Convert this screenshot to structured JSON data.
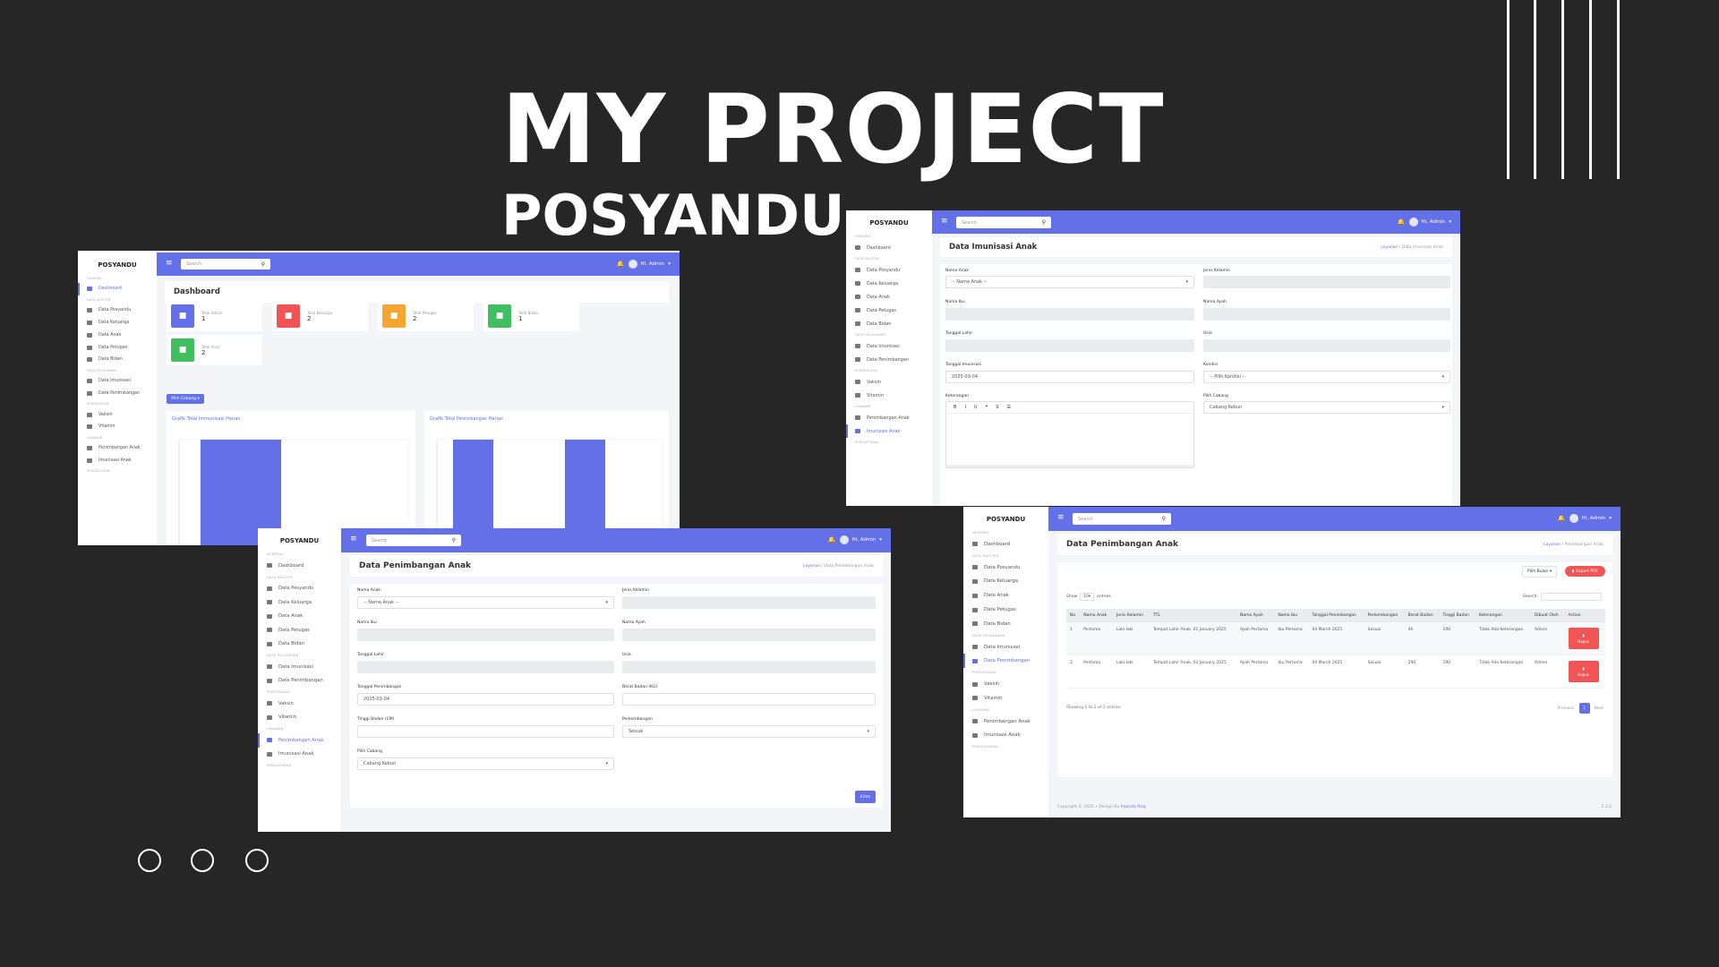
{
  "headline": {
    "title": "MY PROJECT",
    "subtitle": "POSYANDU"
  },
  "colors": {
    "primary": "#6370e8",
    "danger": "#f05454",
    "warning": "#f4a630",
    "success": "#3fbf5f"
  },
  "common": {
    "brand": "POSYANDU",
    "search_placeholder": "Search",
    "user_label": "Hi, Admin",
    "sidebar": [
      {
        "type": "section",
        "label": "GENERAL"
      },
      {
        "label": "Dashboard",
        "icon": "gauge-icon"
      },
      {
        "type": "section",
        "label": "DATA MASTER"
      },
      {
        "label": "Data Posyandu",
        "icon": "car-icon"
      },
      {
        "label": "Data Keluarga",
        "icon": "person-icon"
      },
      {
        "label": "Data Anak",
        "icon": "children-icon"
      },
      {
        "label": "Data Petugas",
        "icon": "book-icon"
      },
      {
        "label": "Data Bidan",
        "icon": "user-icon"
      },
      {
        "type": "section",
        "label": "DATA PELAYANAN"
      },
      {
        "label": "Data Imunisasi",
        "icon": "syringe-icon"
      },
      {
        "label": "Data Penimbangan",
        "icon": "scale-icon"
      },
      {
        "type": "section",
        "label": "PERSEDIAAN"
      },
      {
        "label": "Vaksin",
        "icon": "vial-icon"
      },
      {
        "label": "Vitamin",
        "icon": "pill-icon"
      },
      {
        "type": "section",
        "label": "LAYANAN"
      },
      {
        "label": "Penimbangan Anak",
        "icon": "crown-icon"
      },
      {
        "label": "Imunisasi Anak",
        "icon": "pen-icon"
      },
      {
        "type": "section",
        "label": "PENGATURAN"
      }
    ]
  },
  "dashboard": {
    "title": "Dashboard",
    "stats": [
      {
        "label": "Total Admin",
        "value": "1",
        "color": "#6370e8",
        "icon": "user-icon"
      },
      {
        "label": "Total Keluarga",
        "value": "2",
        "color": "#f05454",
        "icon": "person-icon"
      },
      {
        "label": "Total Petugas",
        "value": "2",
        "color": "#f4a630",
        "icon": "book-icon"
      },
      {
        "label": "Total Bidan",
        "value": "1",
        "color": "#3fbf5f",
        "icon": "user-icon"
      },
      {
        "label": "Total Anak",
        "value": "2",
        "color": "#3fbf5f",
        "icon": "children-icon"
      }
    ],
    "branch_button": "Pilih Cabang",
    "chart_left_title": "Grafik Total Immunisasi Harian",
    "chart_right_title": "Grafik Total Penimbangan Harian"
  },
  "imunisasi": {
    "title": "Data Imunisasi Anak",
    "breadcrumb_root": "Layanan",
    "breadcrumb_current": "Data Imunisasi Anak",
    "labels": {
      "nama_anak": "Nama Anak",
      "jenis_kelamin": "Jenis Kelamin",
      "nama_ibu": "Nama Ibu",
      "nama_ayah": "Nama Ayah",
      "tanggal_lahir": "Tanggal Lahir",
      "usia": "Usia",
      "tanggal_imunisasi": "Tanggal Imunisasi",
      "kondisi": "Kondisi",
      "keterangan": "Keterangan",
      "pilih_cabang": "Pilih Cabang"
    },
    "values": {
      "nama_anak": "-- Nama Anak --",
      "tanggal_imunisasi": "2025-03-04",
      "kondisi": "-- Pilih Kondisi --",
      "cabang": "Cabang Kebun"
    },
    "editor_tools": [
      "B",
      "I",
      "U",
      "❝",
      "S",
      "☰"
    ]
  },
  "penimbangan_form": {
    "title": "Data Penimbangan Anak",
    "breadcrumb_root": "Layanan",
    "breadcrumb_current": "Data Penimbangan Anak",
    "labels": {
      "nama_anak": "Nama Anak",
      "jenis_kelamin": "Jenis Kelamin",
      "nama_ibu": "Nama Ibu",
      "nama_ayah": "Nama Ayah",
      "tanggal_lahir": "Tanggal Lahir",
      "usia": "Usia",
      "tanggal_penimbangan": "Tanggal Penimbangan",
      "berat_badan": "Berat Badan (KG)",
      "tinggi_badan": "Tinggi Badan (CM)",
      "perkembangan": "Perkembangan",
      "pilih_cabang": "Pilih Cabang"
    },
    "values": {
      "nama_anak": "-- Nama Anak --",
      "tanggal_penimbangan": "2025-03-04",
      "perkembangan": "Sesuai",
      "cabang": "Cabang Kebun"
    },
    "submit": "Kirim"
  },
  "penimbangan_table": {
    "title": "Data Penimbangan Anak",
    "breadcrumb_root": "Layanan",
    "breadcrumb_current": "Penimbangan Anak",
    "month_select": "Pilih Bulan",
    "export_button": "Export PDF",
    "show_prefix": "Show",
    "show_value": "10",
    "show_suffix": "entries",
    "search_label": "Search:",
    "columns": [
      "No",
      "Nama Anak",
      "Jenis Kelamin",
      "TTL",
      "Nama Ayah",
      "Nama Ibu",
      "Tanggal Penimbangan",
      "Perkembangan",
      "Berat Badan",
      "Tinggi Badan",
      "Keterangan",
      "Dibuat Oleh",
      "Action"
    ],
    "rows": [
      [
        "1",
        "Pertama",
        "Laki-laki",
        "Tempat Lahir Anak, 01 January 2025",
        "Ayah Pertama",
        "Ibu Pertama",
        "04 March 2025",
        "Sesuai",
        "40",
        "190",
        "Tidak Ada Keterangan",
        "Admin"
      ],
      [
        "2",
        "Pertama",
        "Laki-laki",
        "Tempat Lahir Anak, 01 January 2025",
        "Ayah Pertama",
        "Ibu Pertama",
        "04 March 2025",
        "Sesuai",
        "290",
        "190",
        "Tidak Ada Keterangan",
        "Admin"
      ]
    ],
    "delete_label": "Hapus",
    "info": "Showing 1 to 2 of 2 entries",
    "prev": "Previous",
    "page": "1",
    "next": "Next",
    "footer": "Copyright © 2025 • Design By",
    "footer_author": "Ananda Rizq",
    "version": "2.3.0"
  }
}
